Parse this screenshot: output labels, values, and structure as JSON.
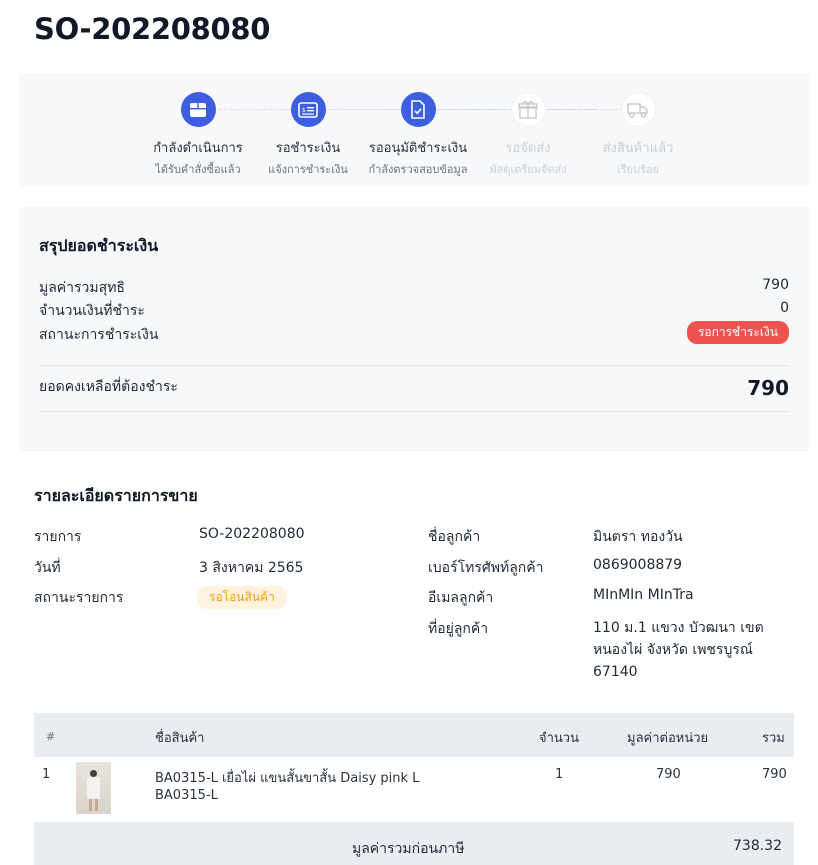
{
  "order": {
    "number": "SO-202208080"
  },
  "stepper": {
    "steps": [
      {
        "title": "กำลังดำเนินการ",
        "subtitle": "ได้รับคำสั่งซื้อแล้ว",
        "icon": "box-icon",
        "state": "done"
      },
      {
        "title": "รอชำระเงิน",
        "subtitle": "แจ้งการชำระเงิน",
        "icon": "payment-card-icon",
        "state": "done"
      },
      {
        "title": "รออนุมัติชำระเงิน",
        "subtitle": "กำลังตรวจสอบข้อมูล",
        "icon": "document-check-icon",
        "state": "done"
      },
      {
        "title": "รอจัดส่ง",
        "subtitle": "พัสดุเตรียมจัดส่ง",
        "icon": "gift-box-icon",
        "state": "todo"
      },
      {
        "title": "ส่งสินค้าแล้ว",
        "subtitle": "เรียบร้อย",
        "icon": "truck-icon",
        "state": "todo"
      }
    ]
  },
  "summary": {
    "title": "สรุปยอดชำระเงิน",
    "net_total_label": "มูลค่ารวมสุทธิ",
    "net_total_value": "790",
    "paid_label": "จำนวนเงินที่ชำระ",
    "paid_value": "0",
    "payment_status_label": "สถานะการชำระเงิน",
    "payment_status_value": "รอการชำระเงิน",
    "balance_label": "ยอดคงเหลือที่ต้องชำระ",
    "balance_value": "790"
  },
  "details": {
    "title": "รายละเอียดรายการขาย",
    "item_label": "รายการ",
    "item_value": "SO-202208080",
    "date_label": "วันที่",
    "date_value": "3 สิงหาคม 2565",
    "status_label": "สถานะรายการ",
    "status_value": "รอโอนสินค้า",
    "customer_name_label": "ชื่อลูกค้า",
    "customer_name_value": "มินตรา ทองวัน",
    "phone_label": "เบอร์โทรศัพท์ลูกค้า",
    "phone_value": "0869008879",
    "email_label": "อีเมลลูกค้า",
    "email_value": "MInMIn MInTra",
    "address_label": "ที่อยู่ลูกค้า",
    "address_value": "110 ม.1 แขวง บัวฒนา เขต หนองไผ่ จังหวัด เพชรบูรณ์ 67140"
  },
  "table": {
    "headers": {
      "index": "#",
      "product": "ชื่อสินค้า",
      "qty": "จำนวน",
      "unit_price": "มูลค่าต่อหน่วย",
      "total": "รวม"
    },
    "rows": [
      {
        "index": "1",
        "name": "BA0315-L เยื่อไผ่ แขนสั้นขาสั้น Daisy pink L",
        "sku": "BA0315-L",
        "qty": "1",
        "unit_price": "790",
        "total": "790"
      }
    ]
  },
  "totals": {
    "pre_tax_label": "มูลค่ารวมก่อนภาษี",
    "pre_tax_value": "738.32"
  },
  "colors": {
    "accent": "#3d5ee1",
    "danger": "#ef5350",
    "warning": "#f59e0b",
    "panel": "#f7f8fa"
  }
}
